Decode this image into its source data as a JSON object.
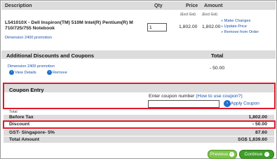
{
  "table_header": {
    "description": "Description",
    "qty": "Qty",
    "price": "Price",
    "amount": "Amount"
  },
  "item": {
    "title": "L541010X - Dell Inspiron(TM) 510M Intel(R) Pentium(R) M 710/725/755 Notebook",
    "promotion": "Dimension 2400 promotion",
    "qty": "1",
    "price_note": "(Excl Gst)",
    "price": "1,802.00",
    "amount_note": "(Excl Gst)",
    "amount": "1,802.00",
    "actions": [
      "Make Changes",
      "Update Price",
      "Remove from Order"
    ]
  },
  "additional": {
    "heading": "Additional Discounts and Coupons",
    "total_label": "Total",
    "promotion": "Dimension 2400 promotion",
    "view_details": "View Details",
    "remove": "Remove",
    "amount": "- 50.00"
  },
  "coupon": {
    "heading": "Coupon Entry",
    "prompt": "Enter coupon number",
    "help_link": "(How to use coupon?)",
    "input_value": "",
    "apply_label": "Apply Coupon"
  },
  "totals": {
    "heading": "Total",
    "rows": [
      {
        "label": "Before Tax",
        "value": "1,802.00"
      },
      {
        "label": "Discount",
        "value": "- 50.00"
      },
      {
        "label": "GST- Singapore- 5%",
        "value": "87.60"
      },
      {
        "label": "Total Amount",
        "value": "SG$ 1,839.60"
      }
    ]
  },
  "buttons": {
    "previous": "Previous",
    "continue": "Continue"
  },
  "colors": {
    "highlight_red": "#e01a2b",
    "link_blue": "#1a4fa8",
    "button_green": "#3f9d2a"
  }
}
